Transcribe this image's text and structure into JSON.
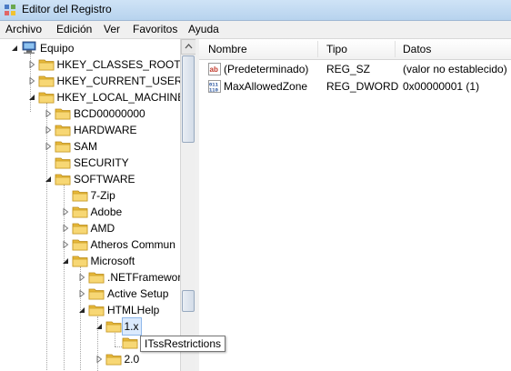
{
  "window": {
    "title": "Editor del Registro"
  },
  "menu": [
    "Archivo",
    "Edición",
    "Ver",
    "Favoritos",
    "Ayuda"
  ],
  "tree": {
    "items": [
      {
        "label": "Equipo",
        "level": 0,
        "type": "computer",
        "expander": "expanded"
      },
      {
        "label": "HKEY_CLASSES_ROOT",
        "level": 1,
        "expander": "collapsed"
      },
      {
        "label": "HKEY_CURRENT_USER",
        "level": 1,
        "expander": "collapsed"
      },
      {
        "label": "HKEY_LOCAL_MACHINE",
        "level": 1,
        "expander": "expanded"
      },
      {
        "label": "BCD00000000",
        "level": 2,
        "expander": "collapsed"
      },
      {
        "label": "HARDWARE",
        "level": 2,
        "expander": "collapsed"
      },
      {
        "label": "SAM",
        "level": 2,
        "expander": "collapsed"
      },
      {
        "label": "SECURITY",
        "level": 2,
        "expander": "none"
      },
      {
        "label": "SOFTWARE",
        "level": 2,
        "expander": "expanded"
      },
      {
        "label": "7-Zip",
        "level": 3,
        "expander": "none"
      },
      {
        "label": "Adobe",
        "level": 3,
        "expander": "collapsed"
      },
      {
        "label": "AMD",
        "level": 3,
        "expander": "collapsed"
      },
      {
        "label": "Atheros Commun",
        "level": 3,
        "expander": "collapsed"
      },
      {
        "label": "Microsoft",
        "level": 3,
        "expander": "expanded"
      },
      {
        "label": ".NETFramewor",
        "level": 4,
        "expander": "collapsed"
      },
      {
        "label": "Active Setup",
        "level": 4,
        "expander": "collapsed"
      },
      {
        "label": "HTMLHelp",
        "level": 4,
        "expander": "expanded"
      },
      {
        "label": "1.x",
        "level": 5,
        "expander": "expanded",
        "selected": true
      },
      {
        "label": "",
        "level": 6,
        "expander": "none"
      },
      {
        "label": "2.0",
        "level": 5,
        "expander": "collapsed"
      }
    ]
  },
  "tooltip": "ITssRestrictions",
  "list": {
    "columns": [
      "Nombre",
      "Tipo",
      "Datos"
    ],
    "rows": [
      {
        "name": "(Predeterminado)",
        "type": "REG_SZ",
        "data": "(valor no establecido)",
        "icon": "string-value-icon"
      },
      {
        "name": "MaxAllowedZone",
        "type": "REG_DWORD",
        "data": "0x00000001 (1)",
        "icon": "binary-value-icon"
      }
    ]
  },
  "colors": {
    "selection": "#dbeafd",
    "folder": "#f2c94c",
    "titlebar": "#c4dbf2"
  }
}
